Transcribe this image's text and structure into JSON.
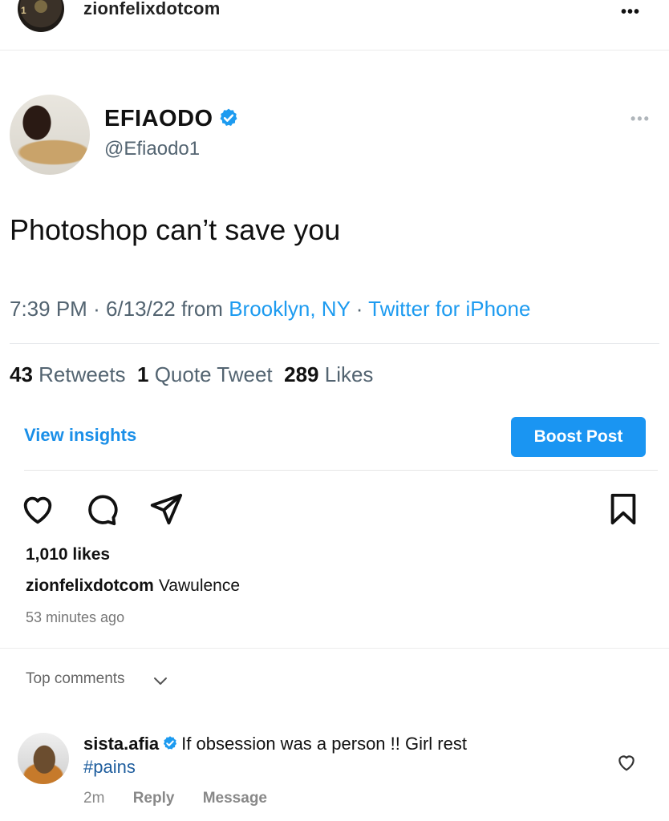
{
  "post_header": {
    "username": "zionfelixdotcom",
    "more_label": "•••"
  },
  "tweet": {
    "name": "EFIAODO",
    "handle": "@Efiaodo1",
    "more_label": "•••",
    "text": "Photoshop can’t save you",
    "time": "7:39 PM",
    "date": "6/13/22",
    "from_label": "from",
    "location": "Brooklyn, NY",
    "source": "Twitter for iPhone",
    "separator": "·",
    "stats": {
      "retweets_count": "43",
      "retweets_label": "Retweets",
      "quotes_count": "1",
      "quotes_label": "Quote Tweet",
      "likes_count": "289",
      "likes_label": "Likes"
    }
  },
  "actions": {
    "view_insights": "View insights",
    "boost_post": "Boost Post"
  },
  "post": {
    "likes": "1,010 likes",
    "caption_user": "zionfelixdotcom",
    "caption_text": "Vawulence",
    "time_ago": "53 minutes ago",
    "top_comments_label": "Top comments"
  },
  "comment": {
    "username": "sista.afia",
    "text": "If obsession was a person !! Girl rest",
    "hashtag": "#pains",
    "time": "2m",
    "reply_label": "Reply",
    "message_label": "Message"
  },
  "colors": {
    "link_blue": "#1d9bf0",
    "instagram_blue": "#1a95f2",
    "verified_blue": "#1d9bf0"
  }
}
